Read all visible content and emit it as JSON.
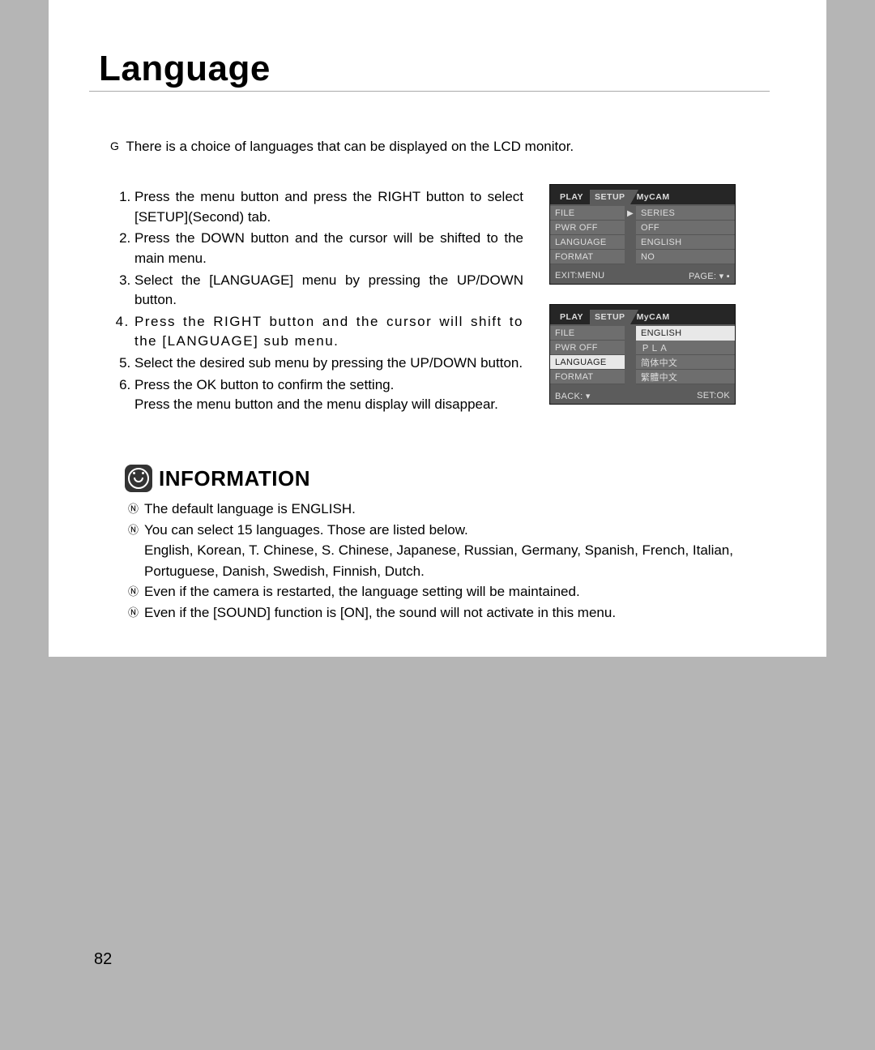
{
  "title": "Language",
  "intro_bullet": "G",
  "intro_text": "There is a choice of languages that can be displayed on the LCD monitor.",
  "steps": [
    "Press the menu button and press the RIGHT button to select [SETUP](Second) tab.",
    "Press the DOWN button and the cursor will be shifted to the main menu.",
    "Select the [LANGUAGE] menu by pressing the UP/DOWN button.",
    "Press the RIGHT button and the cursor will shift to the [LANGUAGE] sub menu.",
    "Select the desired sub menu by pressing the UP/DOWN button.",
    "Press the OK button to confirm the setting."
  ],
  "step6_extra": "Press the menu button and the menu display will disappear.",
  "lcd1": {
    "tabs": [
      "PLAY",
      "SETUP",
      "MyCAM"
    ],
    "rows": [
      {
        "left": "FILE",
        "right": "SERIES",
        "arrow": true
      },
      {
        "left": "PWR OFF",
        "right": "OFF"
      },
      {
        "left": "LANGUAGE",
        "right": "ENGLISH"
      },
      {
        "left": "FORMAT",
        "right": "NO"
      }
    ],
    "foot_left": "EXIT:MENU",
    "foot_right": "PAGE: ▾ ▪"
  },
  "lcd2": {
    "tabs": [
      "PLAY",
      "SETUP",
      "MyCAM"
    ],
    "rows": [
      {
        "left": "FILE",
        "right": "ENGLISH",
        "rsel": true
      },
      {
        "left": "PWR OFF",
        "right": "ＰＬＡ"
      },
      {
        "left": "LANGUAGE",
        "right": "简体中文",
        "lsel": true
      },
      {
        "left": "FORMAT",
        "right": "繁體中文"
      }
    ],
    "foot_left": "BACK: ▾",
    "foot_right": "SET:OK"
  },
  "info_title": "INFORMATION",
  "info_marker": "Ⓝ",
  "info_items": [
    "The default language is ENGLISH.",
    "You can select 15 languages. Those are listed below.",
    "Even if the camera is restarted, the language setting will be maintained.",
    "Even if the [SOUND] function is [ON], the sound will not activate in this menu."
  ],
  "info_lang_list": "English, Korean, T. Chinese, S. Chinese, Japanese, Russian, Germany, Spanish, French, Italian, Portuguese, Danish, Swedish, Finnish, Dutch.",
  "page_number": "82"
}
